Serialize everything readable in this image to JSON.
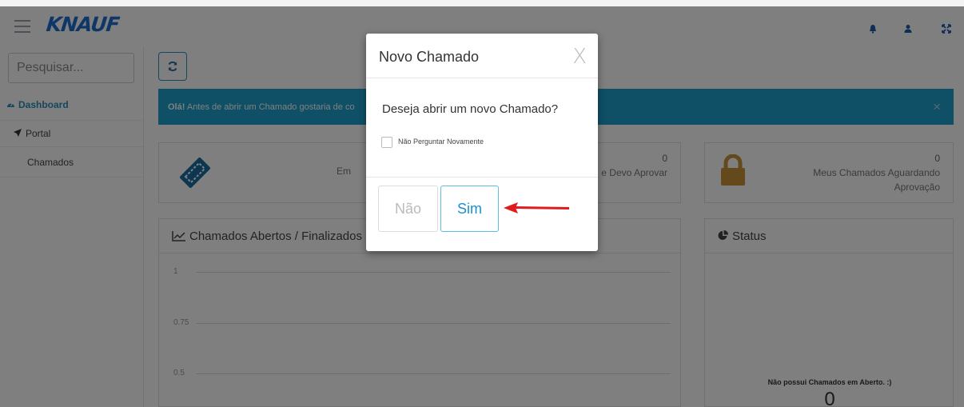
{
  "header": {
    "logo_text": "KNAUF",
    "icons": [
      "bell-icon",
      "user-icon",
      "expand-icon"
    ]
  },
  "sidebar": {
    "search_placeholder": "Pesquisar...",
    "items": [
      {
        "label": "Dashboard",
        "icon": "dashboard-icon"
      },
      {
        "label": "Portal",
        "icon": "send-icon"
      },
      {
        "label": "Chamados"
      }
    ]
  },
  "alert": {
    "bold": "Olá!",
    "text": " Antes de abrir um Chamado gostaria de co",
    "close": "×"
  },
  "cards": {
    "card1": {
      "left_label": "Em",
      "count": "0",
      "right_label": "e Devo Aprovar"
    },
    "card2": {
      "count": "0",
      "label_line1": "Meus Chamados Aguardando",
      "label_line2": "Aprovação"
    }
  },
  "chart_panel": {
    "title": "Chamados Abertos / Finalizados p"
  },
  "chart_data": {
    "type": "line",
    "title": "Chamados Abertos / Finalizados p",
    "y_ticks": [
      "1",
      "0.75",
      "0.5"
    ],
    "series": []
  },
  "status_panel": {
    "title": "Status",
    "empty_message": "Não possui Chamados em Aberto. :)",
    "empty_count": "0"
  },
  "modal": {
    "title": "Novo Chamado",
    "close": "X",
    "question": "Deseja abrir um novo Chamado?",
    "checkbox_label": "Não Perguntar Novamente",
    "btn_no": "Não",
    "btn_yes": "Sim"
  },
  "colors": {
    "accent": "#1fa0cf",
    "logo": "#1c6fd1",
    "lock": "#c9933a",
    "arrow": "#e01b1b"
  }
}
